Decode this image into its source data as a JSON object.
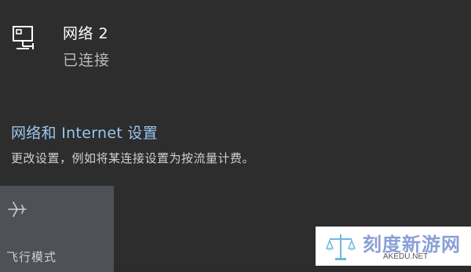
{
  "network": {
    "name": "网络 2",
    "status": "已连接",
    "icon": "ethernet-computer-icon"
  },
  "settings": {
    "link_label": "网络和 Internet 设置",
    "description": "更改设置，例如将某连接设置为按流量计费。"
  },
  "quick_actions": [
    {
      "label": "飞行模式",
      "icon": "airplane-icon"
    }
  ],
  "watermark": {
    "brand": "刻度新游网",
    "domain": "AKEDU.NET"
  },
  "colors": {
    "background": "#2d2d2d",
    "link": "#98c6ee",
    "tile": "#4e5155"
  }
}
